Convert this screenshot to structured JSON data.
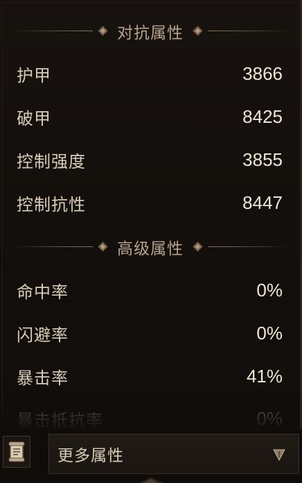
{
  "sections": [
    {
      "title": "对抗属性",
      "rows": [
        {
          "label": "护甲",
          "value": "3866"
        },
        {
          "label": "破甲",
          "value": "8425"
        },
        {
          "label": "控制强度",
          "value": "3855"
        },
        {
          "label": "控制抗性",
          "value": "8447"
        }
      ]
    },
    {
      "title": "高级属性",
      "rows": [
        {
          "label": "命中率",
          "value": "0%"
        },
        {
          "label": "闪避率",
          "value": "0%"
        },
        {
          "label": "暴击率",
          "value": "41%"
        },
        {
          "label": "暴击抵抗率",
          "value": "0%"
        }
      ]
    }
  ],
  "footer": {
    "dropdown_label": "更多属性",
    "icons": {
      "left_button": "document-scroll-icon",
      "dropdown_arrow": "triangle-down-icon"
    }
  },
  "colors": {
    "label": "#d9ccb6",
    "value": "#efe6d4",
    "section_title": "#b7a48a",
    "accent_line": "#7f6a53"
  }
}
